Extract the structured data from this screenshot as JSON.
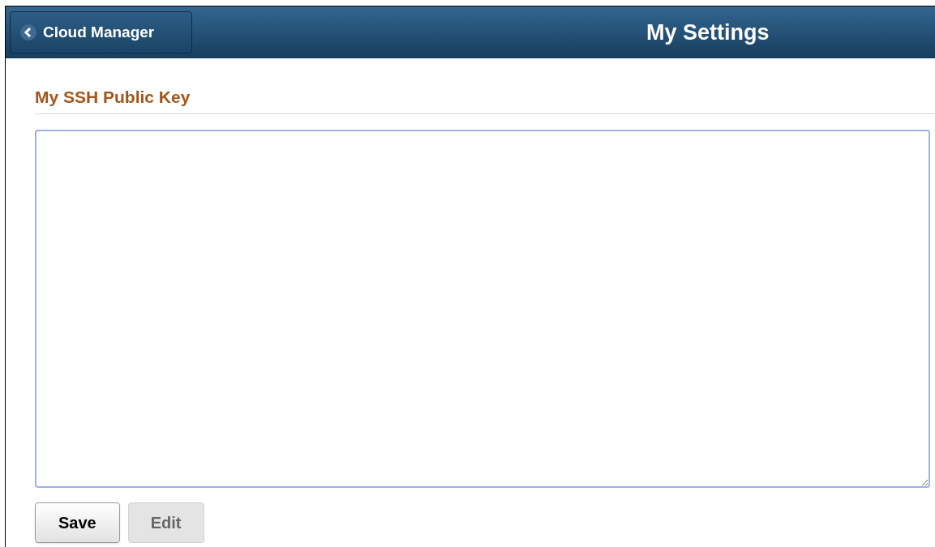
{
  "header": {
    "back_button": {
      "label": "Cloud Manager"
    },
    "title": "My Settings"
  },
  "section": {
    "heading": "My SSH Public Key"
  },
  "key_field": {
    "kind": "textarea"
  },
  "buttons": [
    {
      "label": "Save",
      "disabled": false
    },
    {
      "label": "Edit",
      "disabled": true
    }
  ]
}
